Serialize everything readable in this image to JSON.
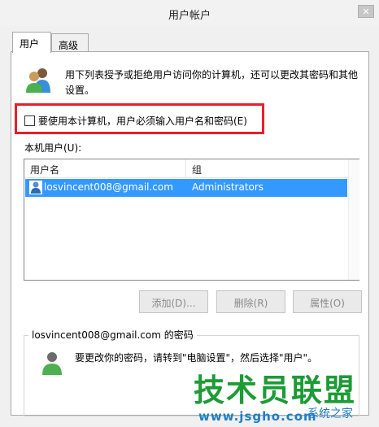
{
  "window": {
    "title": "用户帐户"
  },
  "tabs": [
    {
      "label": "用户",
      "active": true
    },
    {
      "label": "高级",
      "active": false
    }
  ],
  "intro": {
    "text": "用下列表授予或拒绝用户访问你的计算机，还可以更改其密码和其他设置。"
  },
  "login_checkbox": {
    "label": "要使用本计算机，用户必须输入用户名和密码(E)",
    "checked": false
  },
  "users_section": {
    "label": "本机用户(U):",
    "columns": [
      "用户名",
      "组"
    ],
    "rows": [
      {
        "username": "losvincent008@gmail.com",
        "group": "Administrators",
        "selected": true
      }
    ]
  },
  "buttons": {
    "add": "添加(D)...",
    "remove": "删除(R)",
    "properties": "属性(O)"
  },
  "password_group": {
    "title": "losvincent008@gmail.com 的密码",
    "text": "要更改你的密码，请转到\"电脑设置\"，然后选择\"用户\"。"
  },
  "watermark": {
    "brand": "技术员联盟",
    "url": "www.jsgho.com",
    "corner": "系统之家"
  },
  "colors": {
    "selection": "#3399ff",
    "highlight_box": "#e8202a",
    "watermark_green": "#1d9b36",
    "watermark_blue": "#1e7ec8"
  }
}
